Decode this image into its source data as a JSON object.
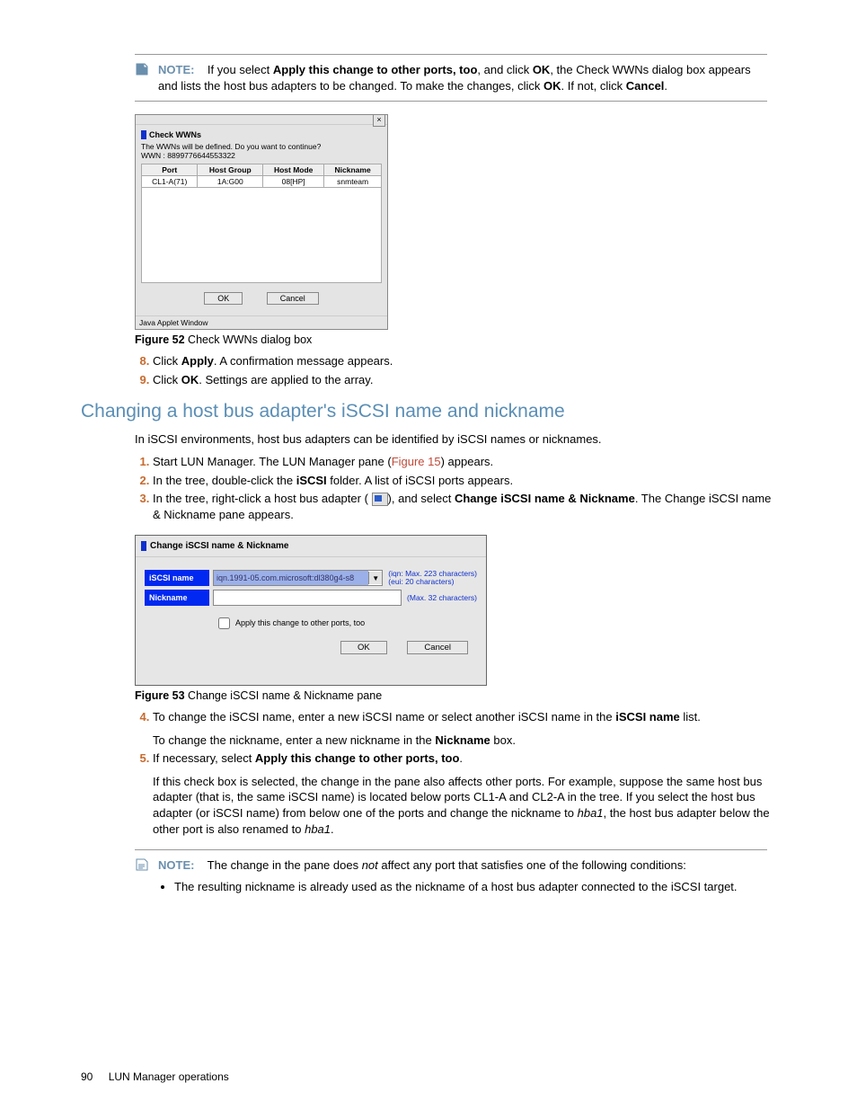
{
  "note1": {
    "label": "NOTE:",
    "text_parts": {
      "a": "If you select ",
      "b": "Apply this change to other ports, too",
      "c": ", and click ",
      "d": "OK",
      "e": ", the Check WWNs dialog box appears and lists the host bus adapters to be changed. To make the changes, click ",
      "f": "OK",
      "g": ". If not, click ",
      "h": "Cancel",
      "i": "."
    }
  },
  "dialog1": {
    "title": "Check WWNs",
    "msg1": "The WWNs will be defined. Do you want to continue?",
    "msg2": "WWN : 8899776644553322",
    "headers": {
      "c1": "Port",
      "c2": "Host Group",
      "c3": "Host Mode",
      "c4": "Nickname"
    },
    "row": {
      "c1": "CL1-A(71)",
      "c2": "1A:G00",
      "c3": "08[HP]",
      "c4": "snmteam"
    },
    "ok": "OK",
    "cancel": "Cancel",
    "status": "Java Applet Window"
  },
  "fig52": {
    "label": "Figure 52",
    "caption": " Check WWNs dialog box"
  },
  "steps_a": {
    "s8_a": "Click ",
    "s8_b": "Apply",
    "s8_c": ". A confirmation message appears.",
    "s9_a": "Click ",
    "s9_b": "OK",
    "s9_c": ". Settings are applied to the array."
  },
  "section_title": "Changing a host bus adapter's iSCSI name and nickname",
  "intro": "In iSCSI environments, host bus adapters can be identified by iSCSI names or nicknames.",
  "steps_b": {
    "s1_a": "Start LUN Manager. The LUN Manager pane (",
    "s1_link": "Figure 15",
    "s1_b": ") appears.",
    "s2_a": "In the tree, double-click the ",
    "s2_b": "iSCSI",
    "s2_c": " folder. A list of iSCSI ports appears.",
    "s3_a": "In the tree, right-click a host bus adapter (",
    "s3_b": "), and select ",
    "s3_c": "Change iSCSI name & Nickname",
    "s3_d": ". The Change iSCSI name & Nickname pane appears."
  },
  "dialog2": {
    "title": "Change iSCSI name & Nickname",
    "label_iscsi": "iSCSI name",
    "label_nick": "Nickname",
    "combo_value": "iqn.1991-05.com.microsoft:dl380g4-s8",
    "hint_iscsi_l1": "(iqn: Max. 223 characters)",
    "hint_iscsi_l2": "(eui: 20 characters)",
    "hint_nick": "(Max. 32 characters)",
    "chk": "Apply this change to other ports, too",
    "ok": "OK",
    "cancel": "Cancel"
  },
  "fig53": {
    "label": "Figure 53",
    "caption": " Change iSCSI name & Nickname pane"
  },
  "steps_c": {
    "s4_a": "To change the iSCSI name, enter a new iSCSI name or select another iSCSI name in the ",
    "s4_b": "iSCSI name",
    "s4_c": " list.",
    "s4_sub_a": "To change the nickname, enter a new nickname in the ",
    "s4_sub_b": "Nickname",
    "s4_sub_c": " box.",
    "s5_a": "If necessary, select ",
    "s5_b": "Apply this change to other ports, too",
    "s5_c": ".",
    "s5_sub": "If this check box is selected, the change in the pane also affects other ports. For example, suppose the same host bus adapter (that is, the same iSCSI name) is located below ports CL1-A and CL2-A in the tree. If you select the host bus adapter (or iSCSI name) from below one of the ports and change the nickname to ",
    "s5_i1": "hba1",
    "s5_sub2": ", the host bus adapter below the other port is also renamed to ",
    "s5_i2": "hba1",
    "s5_sub3": "."
  },
  "note2": {
    "label": "NOTE:",
    "a": "The change in the pane does ",
    "not": "not",
    "b": " affect any port that satisfies one of the following conditions:",
    "bullet1": "The resulting nickname is already used as the nickname of a host bus adapter connected to the iSCSI target."
  },
  "footer": {
    "page": "90",
    "title": "LUN Manager operations"
  }
}
